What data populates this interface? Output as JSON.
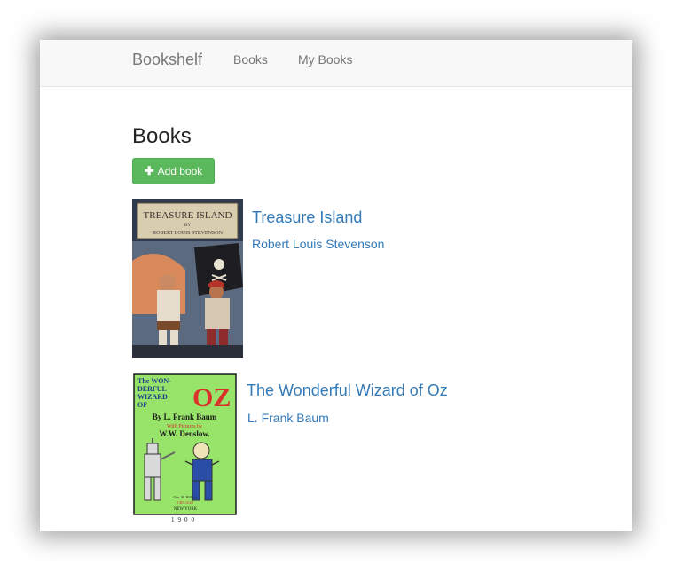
{
  "navbar": {
    "brand": "Bookshelf",
    "links": [
      "Books",
      "My Books"
    ]
  },
  "page": {
    "title": "Books",
    "add_button_label": "Add book"
  },
  "books": [
    {
      "title": "Treasure Island",
      "author": "Robert Louis Stevenson",
      "cover_text": [
        "TREASURE ISLAND",
        "BY",
        "ROBERT LOUIS STEVENSON"
      ]
    },
    {
      "title": "The Wonderful Wizard of Oz",
      "author": "L. Frank Baum",
      "cover_text": [
        "The WON-",
        "DERFUL",
        "WIZARD",
        "OF",
        "OZ",
        "By L. Frank Baum",
        "With Pictures by",
        "W.W. Denslow.",
        "Geo. M. Hill Co.",
        "CHICAGO",
        "NEW YORK",
        "1900"
      ]
    }
  ],
  "colors": {
    "brand_text": "#777777",
    "link": "#337ab7",
    "button_green": "#5cb85c",
    "navbar_bg": "#f8f8f8"
  }
}
